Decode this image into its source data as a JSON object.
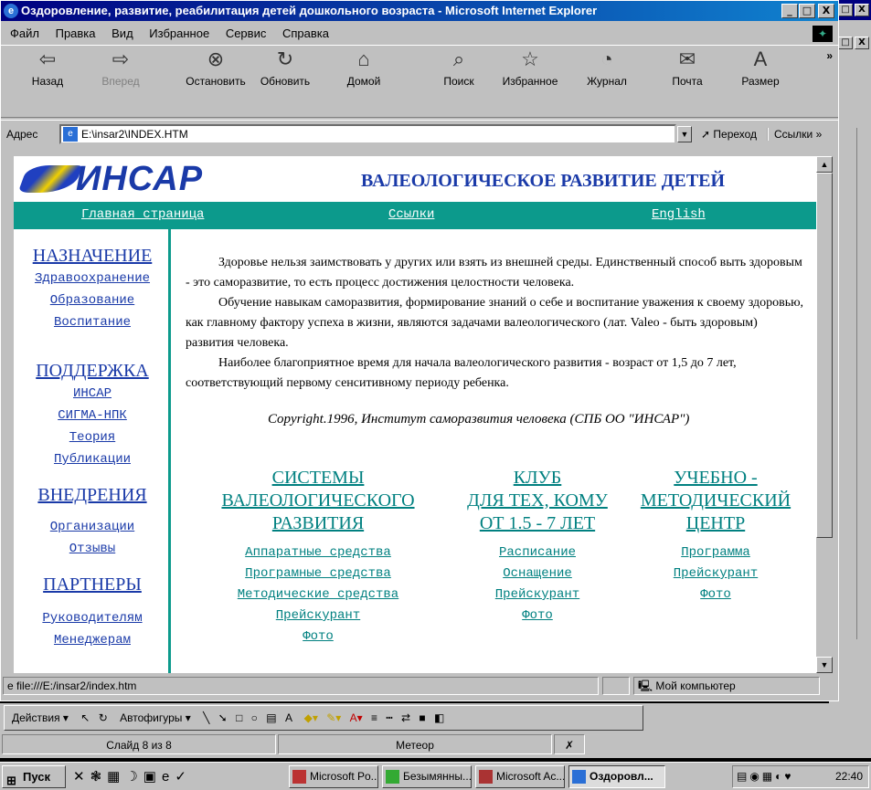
{
  "window": {
    "title": "Оздоровление, развитие, реабилитация детей дошкольного возраста - Microsoft Internet Explorer",
    "controls": [
      "_",
      "□",
      "X"
    ]
  },
  "bg_window_controls": [
    "_",
    "□",
    "X"
  ],
  "menu": [
    "Файл",
    "Правка",
    "Вид",
    "Избранное",
    "Сервис",
    "Справка"
  ],
  "toolbar": [
    {
      "label": "Назад",
      "icon": "back-arrow-icon",
      "glyph": "⇦",
      "enabled": true
    },
    {
      "label": "Вперед",
      "icon": "forward-arrow-icon",
      "glyph": "⇨",
      "enabled": false
    },
    {
      "label": "Остановить",
      "icon": "stop-icon",
      "glyph": "⊗",
      "enabled": true
    },
    {
      "label": "Обновить",
      "icon": "refresh-icon",
      "glyph": "↻",
      "enabled": true
    },
    {
      "label": "Домой",
      "icon": "home-icon",
      "glyph": "⌂",
      "enabled": true
    },
    {
      "label": "Поиск",
      "icon": "search-icon",
      "glyph": "⌕",
      "enabled": true
    },
    {
      "label": "Избранное",
      "icon": "favorites-icon",
      "glyph": "☆",
      "enabled": true
    },
    {
      "label": "Журнал",
      "icon": "history-icon",
      "glyph": "◔",
      "enabled": true
    },
    {
      "label": "Почта",
      "icon": "mail-icon",
      "glyph": "✉",
      "enabled": true
    },
    {
      "label": "Размер",
      "icon": "font-size-icon",
      "glyph": "A",
      "enabled": true
    }
  ],
  "address": {
    "label": "Адрес",
    "value": "E:\\insar2\\INDEX.HTM",
    "go": "Переход",
    "links": "Ссылки"
  },
  "page": {
    "logo": "ИНСАР",
    "banner": "ВАЛЕОЛОГИЧЕСКОЕ РАЗВИТИЕ ДЕТЕЙ",
    "nav": [
      "Главная страница",
      "Ссылки",
      "English"
    ],
    "sidebar": [
      {
        "heading": "НАЗНАЧЕНИЕ",
        "links": [
          "Здравоохранение",
          "Образование",
          "Воспитание"
        ]
      },
      {
        "heading": "ПОДДЕРЖКА",
        "links": [
          "ИНСАР",
          "СИГМА-НПК",
          "Теория",
          "Публикации"
        ]
      },
      {
        "heading": "ВНЕДРЕНИЯ",
        "links": [
          "Организации",
          "Отзывы"
        ]
      },
      {
        "heading": "ПАРТНЕРЫ",
        "links": [
          "Руководителям",
          "Менеджерам"
        ]
      }
    ],
    "paragraphs": [
      "Здоровье нельзя заимствовать у других или взять из внешней среды. Единственный способ выть здоровым - это саморазвитие, то есть процесс достижения целостности человека.",
      "Обучение навыкам саморазвития, формирование знаний о себе и воспитание уважения к своему здоровью, как главному фактору успеха в жизни, являются задачами валеологического (лат. Valeo - быть здоровым) развития человека.",
      "Наиболее благоприятное время для начала валеологического развития - возраст от 1,5 до 7 лет, соответствующий первому сенситивному периоду ребенка."
    ],
    "copyright": "Copyright.1996, Институт саморазвития человека (СПБ ОО \"ИНСАР\")",
    "columns": [
      {
        "heading": [
          "СИСТЕМЫ",
          "ВАЛЕОЛОГИЧЕСКОГО",
          "РАЗВИТИЯ"
        ],
        "links": [
          "Аппаратные средства",
          "Програмные средства",
          "Методические средства",
          "Прейскурант",
          "Фото"
        ]
      },
      {
        "heading": [
          "КЛУБ",
          "ДЛЯ ТЕХ, КОМУ",
          "ОТ 1.5 - 7 ЛЕТ"
        ],
        "links": [
          "Расписание",
          "Оснащение",
          "Прейскурант",
          "Фото"
        ]
      },
      {
        "heading": [
          "УЧЕБНО -",
          "МЕТОДИЧЕСКИЙ",
          "ЦЕНТР"
        ],
        "links": [
          "Программа",
          "Прейскурант",
          "Фото"
        ]
      }
    ]
  },
  "status": {
    "url": "file:///E:/insar2/index.htm",
    "zone": "Мой компьютер"
  },
  "ppt": {
    "actions": "Действия",
    "autoshapes": "Автофигуры",
    "slide": "Слайд 8 из 8",
    "design": "Метеор"
  },
  "taskbar": {
    "start": "Пуск",
    "buttons": [
      "Microsoft Po...",
      "Безымянны...",
      "Microsoft Ac...",
      "Оздоровл..."
    ],
    "clock": "22:40"
  },
  "colors": {
    "titlebar": "#000080",
    "teal": "#0c9a8c",
    "link_blue": "#1a3aa8",
    "link_teal": "#008080"
  }
}
